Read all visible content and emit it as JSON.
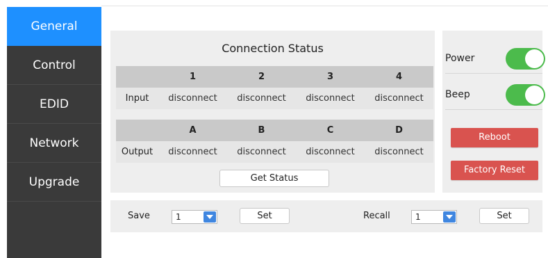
{
  "sidebar": {
    "items": [
      {
        "label": "General",
        "active": true
      },
      {
        "label": "Control"
      },
      {
        "label": "EDID"
      },
      {
        "label": "Network"
      },
      {
        "label": "Upgrade"
      }
    ]
  },
  "status": {
    "title": "Connection Status",
    "input": {
      "row_label": "Input",
      "headers": [
        "1",
        "2",
        "3",
        "4"
      ],
      "values": [
        "disconnect",
        "disconnect",
        "disconnect",
        "disconnect"
      ]
    },
    "output": {
      "row_label": "Output",
      "headers": [
        "A",
        "B",
        "C",
        "D"
      ],
      "values": [
        "disconnect",
        "disconnect",
        "disconnect",
        "disconnect"
      ]
    },
    "get_status_label": "Get Status"
  },
  "controls": {
    "power_label": "Power",
    "power_on": true,
    "beep_label": "Beep",
    "beep_on": true,
    "reboot_label": "Reboot",
    "factory_reset_label": "Factory Reset"
  },
  "preset": {
    "save_label": "Save",
    "save_value": "1",
    "save_set_label": "Set",
    "recall_label": "Recall",
    "recall_value": "1",
    "recall_set_label": "Set"
  },
  "colors": {
    "accent": "#1e90ff",
    "sidebar_bg": "#3a3a3a",
    "toggle_on": "#4cbb4c",
    "danger": "#d9534f"
  }
}
